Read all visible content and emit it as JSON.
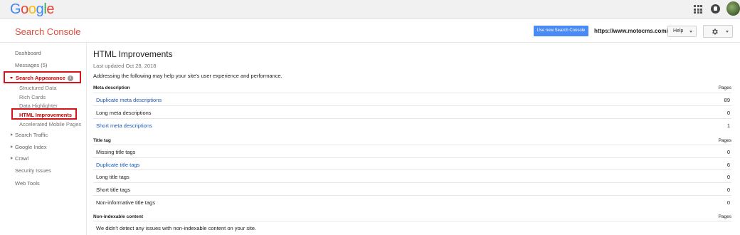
{
  "topbar": {
    "logo_letters": [
      {
        "ch": "G",
        "color": "#4285f4"
      },
      {
        "ch": "o",
        "color": "#ea4335"
      },
      {
        "ch": "o",
        "color": "#fbbc05"
      },
      {
        "ch": "g",
        "color": "#4285f4"
      },
      {
        "ch": "l",
        "color": "#34a853"
      },
      {
        "ch": "e",
        "color": "#ea4335"
      }
    ],
    "apps_icon": "apps-grid-icon",
    "notifications_icon": "notifications-icon",
    "avatar_icon": "account-avatar"
  },
  "header": {
    "brand": "Search Console",
    "new_console_button": "Use new Search Console",
    "site_url": "https://www.motocms.com/",
    "help_button": "Help",
    "settings_icon": "gear-icon"
  },
  "sidebar": {
    "dashboard": "Dashboard",
    "messages": "Messages (5)",
    "search_appearance": "Search Appearance",
    "structured_data": "Structured Data",
    "rich_cards": "Rich Cards",
    "data_highlighter": "Data Highlighter",
    "html_improvements": "HTML Improvements",
    "amp": "Accelerated Mobile Pages",
    "search_traffic": "Search Traffic",
    "google_index": "Google Index",
    "crawl": "Crawl",
    "security_issues": "Security Issues",
    "web_tools": "Web Tools"
  },
  "main": {
    "title": "HTML Improvements",
    "last_updated": "Last updated Oct 28, 2018",
    "intro": "Addressing the following may help your site's user experience and performance.",
    "pages_header": "Pages",
    "meta": {
      "heading": "Meta description",
      "rows": [
        {
          "label": "Duplicate meta descriptions",
          "value": "89",
          "link": true
        },
        {
          "label": "Long meta descriptions",
          "value": "0",
          "link": false
        },
        {
          "label": "Short meta descriptions",
          "value": "1",
          "link": true
        }
      ]
    },
    "title_tag": {
      "heading": "Title tag",
      "rows": [
        {
          "label": "Missing title tags",
          "value": "0",
          "link": false
        },
        {
          "label": "Duplicate title tags",
          "value": "6",
          "link": true
        },
        {
          "label": "Long title tags",
          "value": "0",
          "link": false
        },
        {
          "label": "Short title tags",
          "value": "0",
          "link": false
        },
        {
          "label": "Non-informative title tags",
          "value": "0",
          "link": false
        }
      ]
    },
    "nonindexable": {
      "heading": "Non-indexable content",
      "note": "We didn't detect any issues with non-indexable content on your site."
    }
  },
  "colors": {
    "brand": "#dd4b39",
    "link": "#1a57b5",
    "button_blue": "#4a8af4",
    "highlight_border": "#d5141b"
  }
}
